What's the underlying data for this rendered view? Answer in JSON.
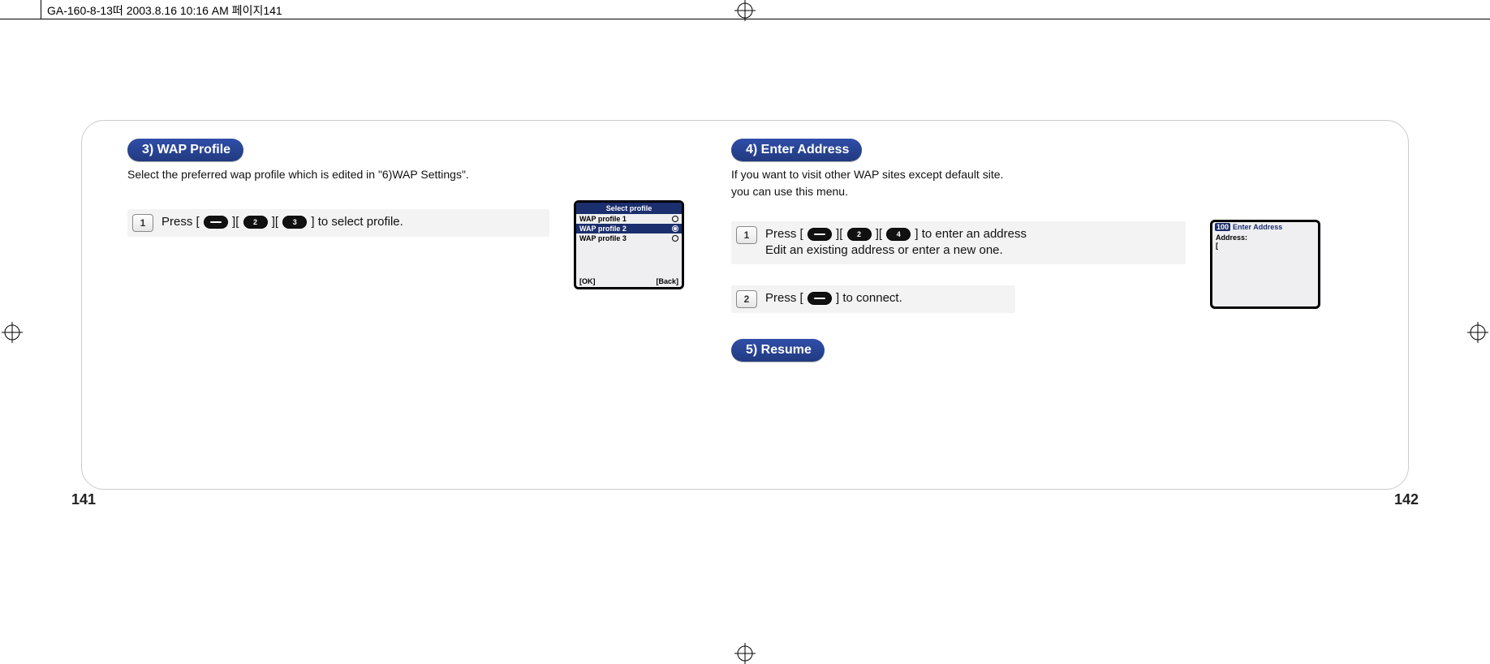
{
  "header": {
    "filename_and_time": "GA-160-8-13떠  2003.8.16 10:16 AM  페이지141"
  },
  "left": {
    "section_title": "3) WAP Profile",
    "section_desc": "Select the preferred wap profile which is edited in \"6)WAP Settings\".",
    "step1_text_a": "Press [",
    "step1_text_b": "][",
    "step1_text_c": "][",
    "step1_text_d": "] to select profile.",
    "phone": {
      "title": "Select profile",
      "row1": "WAP profile 1",
      "row2": "WAP profile 2",
      "row3": "WAP profile 3",
      "soft_left": "[OK]",
      "soft_right": "[Back]"
    }
  },
  "right": {
    "section4_title": "4) Enter Address",
    "section4_desc_line1": "If you want to visit other WAP sites except default site.",
    "section4_desc_line2": "you can use this menu.",
    "step1_text_a": "Press [",
    "step1_text_b": "][",
    "step1_text_c": "][",
    "step1_text_d": "] to enter an address",
    "step1_text_e": "Edit an existing address or enter a new one.",
    "step2_text_a": "Press [",
    "step2_text_b": "] to connect.",
    "phone": {
      "status_num": "100",
      "status_title": "Enter Address",
      "label_address": "Address:",
      "bracket": "["
    },
    "section5_title": "5) Resume"
  },
  "keys": {
    "k2": "2",
    "k3": "3",
    "k4": "4"
  },
  "page_numbers": {
    "left": "141",
    "right": "142"
  }
}
